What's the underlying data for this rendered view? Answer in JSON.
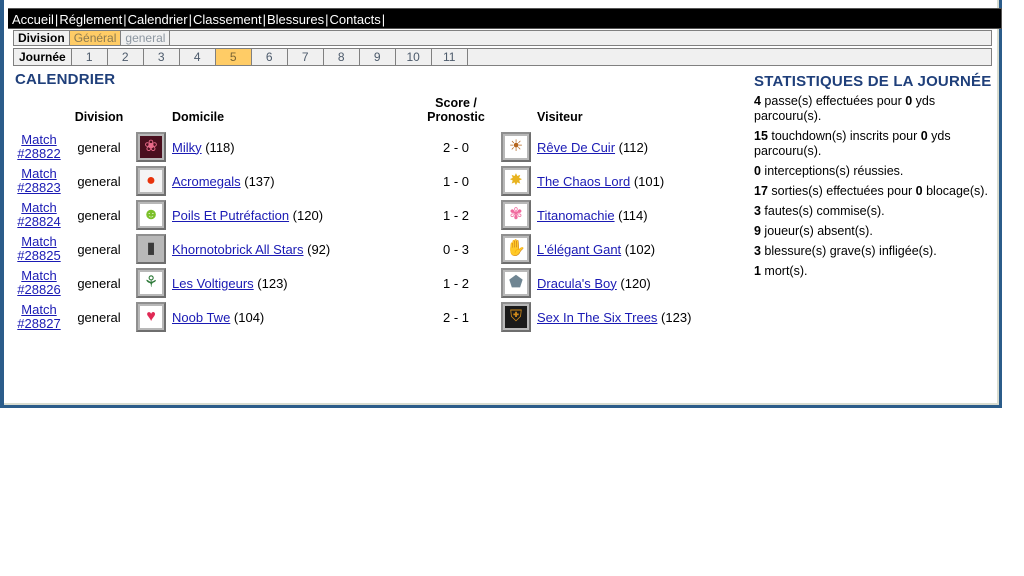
{
  "nav": {
    "items": [
      "Accueil",
      "Réglement",
      "Calendrier",
      "Classement",
      "Blessures",
      "Contacts"
    ],
    "separator": "|"
  },
  "division_bar": {
    "label": "Division",
    "selected": "Général",
    "other": "general"
  },
  "journee_bar": {
    "label": "Journée",
    "days": [
      "1",
      "2",
      "3",
      "4",
      "5",
      "6",
      "7",
      "8",
      "9",
      "10",
      "11"
    ],
    "selected": "5"
  },
  "calendar": {
    "title": "CALENDRIER",
    "headers": {
      "match": "",
      "division": "Division",
      "home_logo": "",
      "home": "Domicile",
      "score": "Score /\nPronostic",
      "score_line1": "Score /",
      "score_line2": "Pronostic",
      "visitor_logo": "",
      "visitor": "Visiteur"
    },
    "rows": [
      {
        "match_line1": "Match",
        "match_line2": "#28822",
        "division": "general",
        "home_logo": "bouquet-icon",
        "home_logo_glyph": "❀",
        "home_logo_fg": "#e86b8a",
        "home_logo_bg": "#4a0f1e",
        "home": "Milky",
        "home_rating": "(118)",
        "score": "2 - 0",
        "visitor_logo": "lion-icon",
        "visitor_logo_glyph": "☀",
        "visitor_logo_fg": "#b5651d",
        "visitor_logo_bg": "#ffffff",
        "visitor": "Rêve De Cuir",
        "visitor_rating": "(112)"
      },
      {
        "match_line1": "Match",
        "match_line2": "#28823",
        "division": "general",
        "home_logo": "red-sphere-icon",
        "home_logo_glyph": "●",
        "home_logo_fg": "#e8340c",
        "home_logo_bg": "#f5f5f5",
        "home": "Acromegals",
        "home_rating": "(137)",
        "score": "1 - 0",
        "visitor_logo": "chaos-star-icon",
        "visitor_logo_glyph": "✸",
        "visitor_logo_fg": "#e8b31f",
        "visitor_logo_bg": "#ffffff",
        "visitor": "The Chaos Lord",
        "visitor_rating": "(101)"
      },
      {
        "match_line1": "Match",
        "match_line2": "#28824",
        "division": "general",
        "home_logo": "green-face-icon",
        "home_logo_glyph": "☻",
        "home_logo_fg": "#7cc02a",
        "home_logo_bg": "#ffffff",
        "home": "Poils Et Putréfaction",
        "home_rating": "(120)",
        "score": "1 - 2",
        "visitor_logo": "octopus-icon",
        "visitor_logo_glyph": "✾",
        "visitor_logo_fg": "#f06a9e",
        "visitor_logo_bg": "#ffffff",
        "visitor": "Titanomachie",
        "visitor_rating": "(114)"
      },
      {
        "match_line1": "Match",
        "match_line2": "#28825",
        "division": "general",
        "home_logo": "blank-bar-icon",
        "home_logo_glyph": "▮",
        "home_logo_fg": "#3a3a3a",
        "home_logo_bg": "#b8b8b8",
        "home": "Khornotobrick All Stars",
        "home_rating": "(92)",
        "score": "0 - 3",
        "visitor_logo": "gauntlet-icon",
        "visitor_logo_glyph": "✋",
        "visitor_logo_fg": "#e8c02a",
        "visitor_logo_bg": "#ffffff",
        "visitor": "L'élégant Gant",
        "visitor_rating": "(102)"
      },
      {
        "match_line1": "Match",
        "match_line2": "#28826",
        "division": "general",
        "home_logo": "acrobat-icon",
        "home_logo_glyph": "⚘",
        "home_logo_fg": "#2f7a3a",
        "home_logo_bg": "#ffffff",
        "home": "Les Voltigeurs",
        "home_rating": "(123)",
        "score": "1 - 2",
        "visitor_logo": "wolf-shield-icon",
        "visitor_logo_glyph": "⬟",
        "visitor_logo_fg": "#6f8592",
        "visitor_logo_bg": "#ffffff",
        "visitor": "Dracula's Boy",
        "visitor_rating": "(120)"
      },
      {
        "match_line1": "Match",
        "match_line2": "#28827",
        "division": "general",
        "home_logo": "heart-icon",
        "home_logo_glyph": "♥",
        "home_logo_fg": "#e02a55",
        "home_logo_bg": "#ffffff",
        "home": "Noob Twe",
        "home_rating": "(104)",
        "score": "2 - 1",
        "visitor_logo": "dark-crest-icon",
        "visitor_logo_glyph": "⛨",
        "visitor_logo_fg": "#d08a1a",
        "visitor_logo_bg": "#1a1a1a",
        "visitor": "Sex In The Six Trees",
        "visitor_rating": "(123)"
      }
    ]
  },
  "stats": {
    "title": "STATISTIQUES DE LA JOURNÉE",
    "lines": [
      {
        "v1": "4",
        "t1": " passe(s) effectuées pour ",
        "v2": "0",
        "t2": " yds parcouru(s)."
      },
      {
        "v1": "15",
        "t1": " touchdown(s) inscrits pour ",
        "v2": "0",
        "t2": " yds parcouru(s)."
      },
      {
        "v1": "0",
        "t1": " interceptions(s) réussies.",
        "v2": "",
        "t2": ""
      },
      {
        "v1": "17",
        "t1": " sorties(s) effectuées pour ",
        "v2": "0",
        "t2": " blocage(s)."
      },
      {
        "v1": "3",
        "t1": " fautes(s) commise(s).",
        "v2": "",
        "t2": ""
      },
      {
        "v1": "9",
        "t1": " joueur(s) absent(s).",
        "v2": "",
        "t2": ""
      },
      {
        "v1": "3",
        "t1": " blessure(s) grave(s) infligée(s).",
        "v2": "",
        "t2": ""
      },
      {
        "v1": "1",
        "t1": " mort(s).",
        "v2": "",
        "t2": ""
      }
    ]
  },
  "colors": {
    "frame": "#2b5c8a",
    "heading": "#1f3f7a",
    "highlight": "#ffcc66",
    "link": "#1a1ab4",
    "navbar_bg": "#000000"
  }
}
